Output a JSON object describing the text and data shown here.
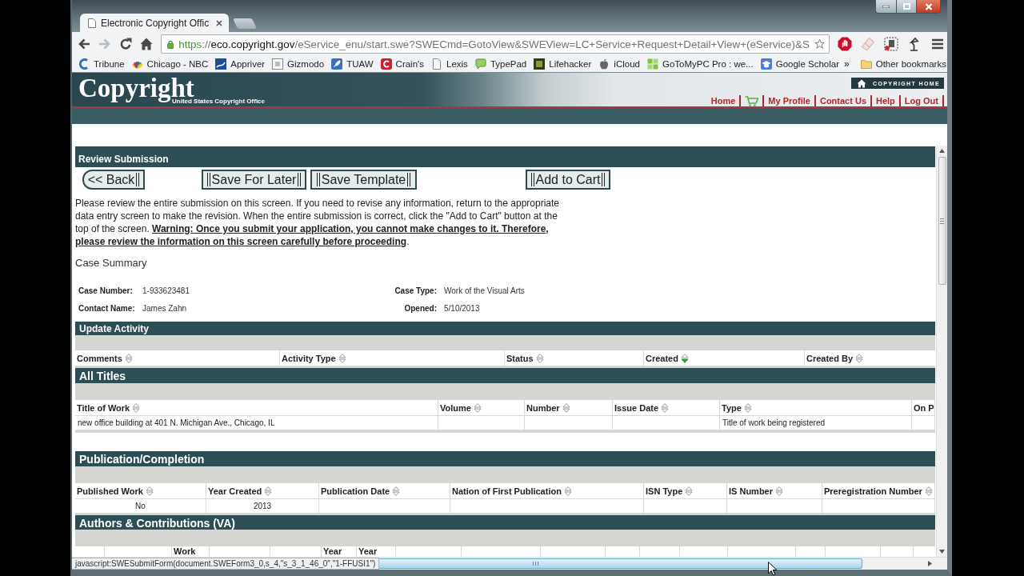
{
  "tabs": [
    {
      "title": "Electronic Copyright Offic",
      "selected": true
    }
  ],
  "toolbar": {
    "forward_disabled": true,
    "url_parts": [
      {
        "kind": "scheme",
        "text": "https"
      },
      {
        "kind": "muted",
        "text": "://"
      },
      {
        "kind": "host",
        "text": "eco.copyright.gov"
      },
      {
        "kind": "muted",
        "text": "/eService_enu/start.swe?SWECmd=GotoView&SWEView=LC+Service+Request+Detail+View+(eService)&S"
      }
    ]
  },
  "bookmarks": {
    "items": [
      {
        "label": "Tribune"
      },
      {
        "label": "Chicago - NBC"
      },
      {
        "label": "Appriver"
      },
      {
        "label": "Gizmodo"
      },
      {
        "label": "TUAW"
      },
      {
        "label": "Crain's"
      },
      {
        "label": "Lexis"
      },
      {
        "label": "TypePad"
      },
      {
        "label": "Lifehacker"
      },
      {
        "label": "iCloud"
      },
      {
        "label": "GoToMyPC Pro : we..."
      },
      {
        "label": "Google Scholar"
      }
    ],
    "overflow": "»",
    "other": "Other bookmarks"
  },
  "site_header": {
    "logo_title": "Copyright",
    "logo_subtitle": "United States Copyright Office",
    "home_button": "COPYRIGHT HOME",
    "nav": [
      {
        "kind": "text",
        "label": "Home"
      },
      {
        "kind": "cart"
      },
      {
        "kind": "text",
        "label": "My Profile"
      },
      {
        "kind": "text",
        "label": "Contact Us"
      },
      {
        "kind": "text",
        "label": "Help"
      },
      {
        "kind": "text",
        "label": "Log Out"
      }
    ]
  },
  "review": {
    "title": "Review Submission",
    "buttons": [
      {
        "kind": "back",
        "label": "<< Back"
      },
      {
        "kind": "bar",
        "label": "Save For Later"
      },
      {
        "kind": "bar",
        "label": "Save Template"
      },
      {
        "kind": "bar",
        "label": "Add to Cart"
      }
    ],
    "instructions": "Please review the entire submission on this screen. If you need to revise any information, return to the appropriate data entry screen to make the revision. When the entire submission is correct, click the \"Add to Cart\" button at the top of the screen. **Warning: Once you submit your application, you cannot make changes to it. Therefore, please review the information on this screen carefully before proceeding**.",
    "case_summary_title": "Case Summary",
    "fields": [
      {
        "label": "Case Number:",
        "value": "1-933623481"
      },
      {
        "label": "Case Type:",
        "value": "Work of the Visual Arts"
      },
      {
        "label": "Contact Name:",
        "value": "James Zahn"
      },
      {
        "label": "Opened:",
        "value": "5/10/2013"
      }
    ]
  },
  "sections": [
    {
      "title": "Update Activity",
      "columns": [
        {
          "label": "Comments",
          "sorted": false
        },
        {
          "label": "Activity Type",
          "sorted": false
        },
        {
          "label": "Status",
          "sorted": false
        },
        {
          "label": "Created",
          "sorted": true
        },
        {
          "label": "Created By",
          "sorted": false
        }
      ]
    },
    {
      "title": "All Titles",
      "columns": [
        {
          "label": "Title of Work",
          "sorted": false
        },
        {
          "label": "Volume",
          "sorted": false
        },
        {
          "label": "Number",
          "sorted": false
        },
        {
          "label": "Issue Date",
          "sorted": false
        },
        {
          "label": "Type",
          "sorted": false
        },
        {
          "label": "On P"
        }
      ],
      "rows": [
        [
          "new office building at 401 N. Michigan Ave., Chicago, IL",
          null,
          null,
          null,
          "Title of work being registered",
          null
        ]
      ]
    },
    {
      "title": "Publication/Completion",
      "columns": [
        {
          "label": "Published Work",
          "sorted": false
        },
        {
          "label": "Year Created",
          "sorted": false
        },
        {
          "label": "Publication Date",
          "sorted": false
        },
        {
          "label": "Nation of First Publication",
          "sorted": false
        },
        {
          "label": "ISN Type",
          "sorted": false
        },
        {
          "label": "IS Number",
          "sorted": false
        },
        {
          "label": "Preregistration Number",
          "sorted": false
        }
      ],
      "rows": [
        [
          "No",
          "2013",
          null,
          null,
          null,
          null,
          null
        ]
      ]
    },
    {
      "title": "Authors & Contributions (VA)",
      "columns": [
        {},
        {},
        {
          "label": "Work"
        },
        {},
        {},
        {
          "label": "Year"
        },
        {
          "label": "Year"
        },
        {},
        {},
        {},
        {},
        {},
        {},
        {},
        {},
        {},
        {},
        {}
      ]
    }
  ],
  "status_text": "javascript:SWESubmitForm(document.SWEForm3_0,s_4,\"s_3_1_46_0\",\"1-FFUSI1\")"
}
